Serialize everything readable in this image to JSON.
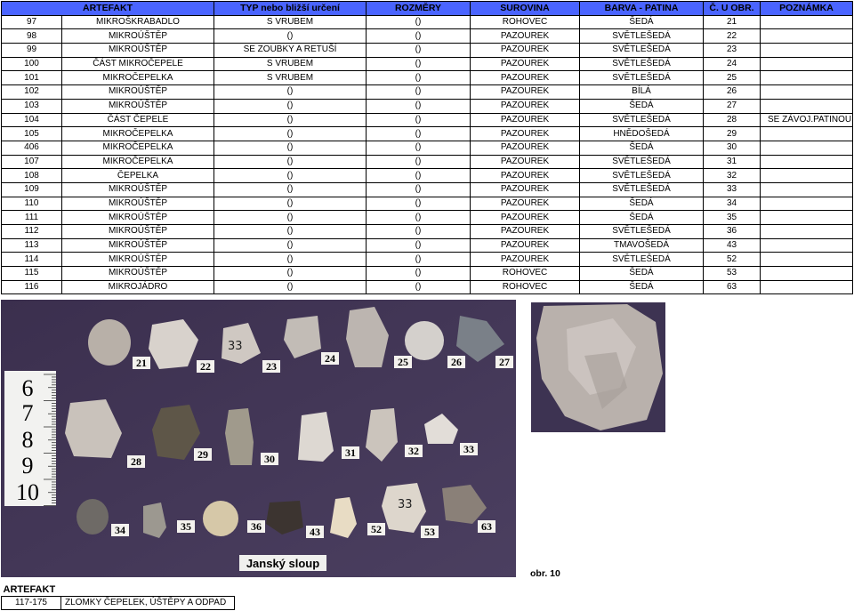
{
  "columns": [
    "ARTEFAKT",
    "TYP nebo bližší určení",
    "ROZMĚRY",
    "SUROVINA",
    "BARVA - PATINA",
    "Č. U OBR.",
    "POZNÁMKA"
  ],
  "rows": [
    [
      "97",
      "MIKROŠKRABADLO",
      "S VRUBEM",
      "()",
      "ROHOVEC",
      "ŠEDÁ",
      "21",
      ""
    ],
    [
      "98",
      "MIKROÚŠTĚP",
      "()",
      "()",
      "PAZOUREK",
      "SVĚTLEŠEDÁ",
      "22",
      ""
    ],
    [
      "99",
      "MIKROÚŠTĚP",
      "SE ZOUBKY A RETUŠÍ",
      "()",
      "PAZOUREK",
      "SVĚTLEŠEDÁ",
      "23",
      ""
    ],
    [
      "100",
      "ČÁST MIKROČEPELE",
      "S VRUBEM",
      "()",
      "PAZOUREK",
      "SVĚTLEŠEDÁ",
      "24",
      ""
    ],
    [
      "101",
      "MIKROČEPELKA",
      "S VRUBEM",
      "()",
      "PAZOUREK",
      "SVĚTLEŠEDÁ",
      "25",
      ""
    ],
    [
      "102",
      "MIKROÚŠTĚP",
      "()",
      "()",
      "PAZOUREK",
      "BÍLÁ",
      "26",
      ""
    ],
    [
      "103",
      "MIKROÚŠTĚP",
      "()",
      "()",
      "PAZOUREK",
      "ŠEDÁ",
      "27",
      ""
    ],
    [
      "104",
      "ČÁST ČEPELE",
      "()",
      "()",
      "PAZOUREK",
      "SVĚTLEŠEDÁ",
      "28",
      "SE ZÁVOJ.PATINOU"
    ],
    [
      "105",
      "MIKROČEPELKA",
      "()",
      "()",
      "PAZOUREK",
      "HNĚDOŠEDÁ",
      "29",
      ""
    ],
    [
      "406",
      "MIKROČEPELKA",
      "()",
      "()",
      "PAZOUREK",
      "ŠEDÁ",
      "30",
      ""
    ],
    [
      "107",
      "MIKROČEPELKA",
      "()",
      "()",
      "PAZOUREK",
      "SVĚTLEŠEDÁ",
      "31",
      ""
    ],
    [
      "108",
      "ČEPELKA",
      "()",
      "()",
      "PAZOUREK",
      "SVĚTLEŠEDÁ",
      "32",
      ""
    ],
    [
      "109",
      "MIKROÚŠTĚP",
      "()",
      "()",
      "PAZOUREK",
      "SVĚTLEŠEDÁ",
      "33",
      ""
    ],
    [
      "110",
      "MIKROÚŠTĚP",
      "()",
      "()",
      "PAZOUREK",
      "ŠEDÁ",
      "34",
      ""
    ],
    [
      "111",
      "MIKROÚŠTĚP",
      "()",
      "()",
      "PAZOUREK",
      "ŠEDÁ",
      "35",
      ""
    ],
    [
      "112",
      "MIKROÚŠTĚP",
      "()",
      "()",
      "PAZOUREK",
      "SVĚTLEŠEDÁ",
      "36",
      ""
    ],
    [
      "113",
      "MIKROÚŠTĚP",
      "()",
      "()",
      "PAZOUREK",
      "TMAVOŠEDÁ",
      "43",
      ""
    ],
    [
      "114",
      "MIKROÚŠTĚP",
      "()",
      "()",
      "PAZOUREK",
      "SVĚTLEŠEDÁ",
      "52",
      ""
    ],
    [
      "115",
      "MIKROÚŠTĚP",
      "()",
      "()",
      "ROHOVEC",
      "ŠEDÁ",
      "53",
      ""
    ],
    [
      "116",
      "MIKROJÁDRO",
      "()",
      "()",
      "ROHOVEC",
      "ŠEDÁ",
      "63",
      ""
    ]
  ],
  "photo": {
    "caption": "Janský sloup",
    "labels": [
      "21",
      "22",
      "23",
      "24",
      "25",
      "26",
      "27",
      "28",
      "29",
      "30",
      "31",
      "32",
      "33",
      "34",
      "35",
      "36",
      "43",
      "52",
      "53",
      "63"
    ],
    "ruler": [
      "6",
      "7",
      "8",
      "9",
      "10"
    ],
    "handwritten": [
      "33",
      "33"
    ]
  },
  "figure_label": "obr. 10",
  "footer": {
    "header": "ARTEFAKT",
    "id": "117-175",
    "description": "ZLOMKY ČEPELEK, ÚŠTĚPY A ODPAD"
  },
  "colors": {
    "header_bg": "#4a64ff",
    "photo_bg": "#3f3452"
  }
}
